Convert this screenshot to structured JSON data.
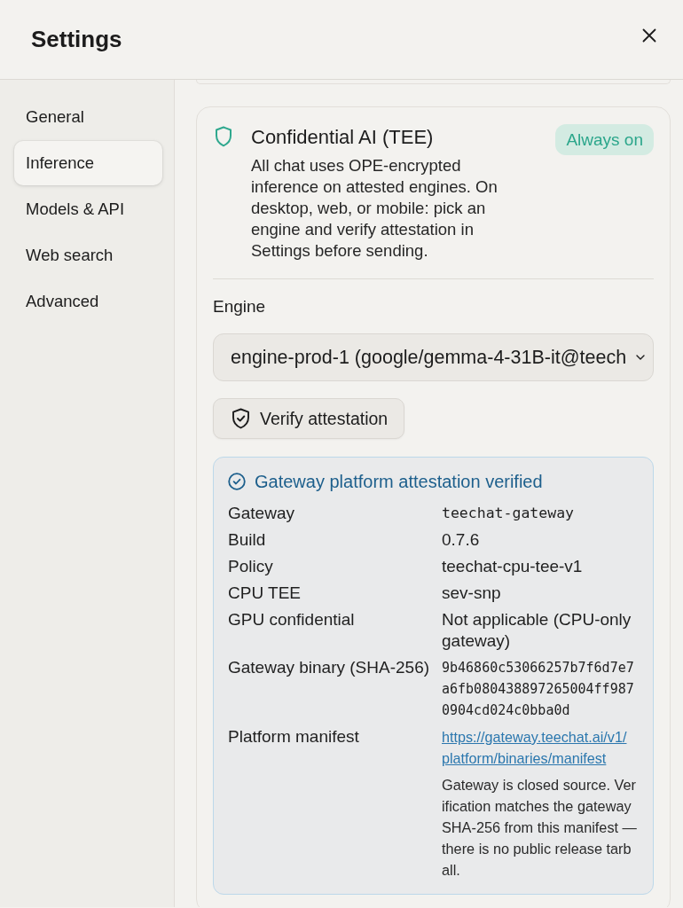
{
  "header": {
    "title": "Settings"
  },
  "sidebar": {
    "items": [
      {
        "label": "General",
        "selected": false
      },
      {
        "label": "Inference",
        "selected": true
      },
      {
        "label": "Models & API",
        "selected": false
      },
      {
        "label": "Web search",
        "selected": false
      },
      {
        "label": "Advanced",
        "selected": false
      }
    ]
  },
  "tee_card": {
    "title": "Confidential AI (TEE)",
    "description": "All chat uses OPE-encrypted inference on attested engines. On desktop, web, or mobile: pick an engine and verify attestation in Settings before sending.",
    "badge": "Always on",
    "engine": {
      "label": "Engine",
      "value": "engine-prod-1 (google/gemma-4-31B-it@teech"
    },
    "verify_button": "Verify attestation",
    "attestation": {
      "title": "Gateway platform attestation verified",
      "rows": [
        {
          "label": "Gateway",
          "kind": "mono",
          "value": "teechat-gateway"
        },
        {
          "label": "Build",
          "kind": "text",
          "value": "0.7.6"
        },
        {
          "label": "Policy",
          "kind": "text",
          "value": "teechat-cpu-tee-v1"
        },
        {
          "label": "CPU TEE",
          "kind": "text",
          "value": "sev-snp"
        },
        {
          "label": "GPU confidential",
          "kind": "text",
          "value": "Not applicable (CPU-only gateway)"
        },
        {
          "label": "Gateway binary (SHA-256)",
          "kind": "hash",
          "value": "9b46860c53066257b7f6d7e7a6fb080438897265004ff9870904cd024c0bba0d"
        },
        {
          "label": "Platform manifest",
          "kind": "link",
          "value": "https://gateway.teechat.ai/v1/platform/binaries/manifest",
          "note": "Gateway is closed source. Verification matches the gateway SHA-256 from this manifest — there is no public release tarball."
        }
      ]
    }
  }
}
